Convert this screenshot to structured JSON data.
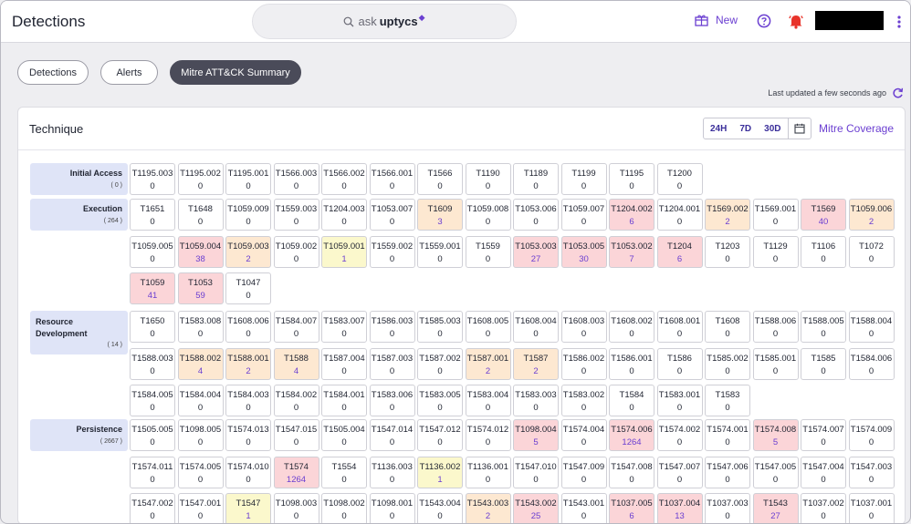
{
  "header": {
    "title": "Detections",
    "search_prefix": "ask",
    "search_brand": "uptycs",
    "new_label": "New"
  },
  "tabs": [
    {
      "label": "Detections",
      "active": false
    },
    {
      "label": "Alerts",
      "active": false
    },
    {
      "label": "Mitre ATT&CK Summary",
      "active": true
    }
  ],
  "last_updated": "Last updated a few seconds ago",
  "panel": {
    "title": "Technique",
    "ranges": [
      "24H",
      "7D",
      "30D"
    ],
    "coverage_label": "Mitre Coverage"
  },
  "tactics": [
    {
      "name": "Initial Access",
      "count": "( 0 )",
      "rows": [
        [
          [
            "T1195.003",
            "0"
          ],
          [
            "T1195.002",
            "0"
          ],
          [
            "T1195.001",
            "0"
          ],
          [
            "T1566.003",
            "0"
          ],
          [
            "T1566.002",
            "0"
          ],
          [
            "T1566.001",
            "0"
          ],
          [
            "T1566",
            "0"
          ],
          [
            "T1190",
            "0"
          ],
          [
            "T1189",
            "0"
          ],
          [
            "T1199",
            "0"
          ],
          [
            "T1195",
            "0"
          ],
          [
            "T1200",
            "0"
          ]
        ]
      ]
    },
    {
      "name": "Execution",
      "count": "( 264 )",
      "rows": [
        [
          [
            "T1651",
            "0"
          ],
          [
            "T1648",
            "0"
          ],
          [
            "T1059.009",
            "0"
          ],
          [
            "T1559.003",
            "0"
          ],
          [
            "T1204.003",
            "0"
          ],
          [
            "T1053.007",
            "0"
          ],
          [
            "T1609",
            "3"
          ],
          [
            "T1059.008",
            "0"
          ],
          [
            "T1053.006",
            "0"
          ],
          [
            "T1059.007",
            "0"
          ],
          [
            "T1204.002",
            "6"
          ],
          [
            "T1204.001",
            "0"
          ],
          [
            "T1569.002",
            "2"
          ],
          [
            "T1569.001",
            "0"
          ],
          [
            "T1569",
            "40"
          ],
          [
            "T1059.006",
            "2"
          ]
        ],
        [
          [
            "T1059.005",
            "0"
          ],
          [
            "T1059.004",
            "38"
          ],
          [
            "T1059.003",
            "2"
          ],
          [
            "T1059.002",
            "0"
          ],
          [
            "T1059.001",
            "1"
          ],
          [
            "T1559.002",
            "0"
          ],
          [
            "T1559.001",
            "0"
          ],
          [
            "T1559",
            "0"
          ],
          [
            "T1053.003",
            "27"
          ],
          [
            "T1053.005",
            "30"
          ],
          [
            "T1053.002",
            "7"
          ],
          [
            "T1204",
            "6"
          ],
          [
            "T1203",
            "0"
          ],
          [
            "T1129",
            "0"
          ],
          [
            "T1106",
            "0"
          ],
          [
            "T1072",
            "0"
          ]
        ],
        [
          [
            "T1059",
            "41"
          ],
          [
            "T1053",
            "59"
          ],
          [
            "T1047",
            "0"
          ]
        ]
      ]
    },
    {
      "name": "Resource Development",
      "count": "( 14 )",
      "rows": [
        [
          [
            "T1650",
            "0"
          ],
          [
            "T1583.008",
            "0"
          ],
          [
            "T1608.006",
            "0"
          ],
          [
            "T1584.007",
            "0"
          ],
          [
            "T1583.007",
            "0"
          ],
          [
            "T1586.003",
            "0"
          ],
          [
            "T1585.003",
            "0"
          ],
          [
            "T1608.005",
            "0"
          ],
          [
            "T1608.004",
            "0"
          ],
          [
            "T1608.003",
            "0"
          ],
          [
            "T1608.002",
            "0"
          ],
          [
            "T1608.001",
            "0"
          ],
          [
            "T1608",
            "0"
          ],
          [
            "T1588.006",
            "0"
          ],
          [
            "T1588.005",
            "0"
          ],
          [
            "T1588.004",
            "0"
          ]
        ],
        [
          [
            "T1588.003",
            "0"
          ],
          [
            "T1588.002",
            "4"
          ],
          [
            "T1588.001",
            "2"
          ],
          [
            "T1588",
            "4"
          ],
          [
            "T1587.004",
            "0"
          ],
          [
            "T1587.003",
            "0"
          ],
          [
            "T1587.002",
            "0"
          ],
          [
            "T1587.001",
            "2"
          ],
          [
            "T1587",
            "2"
          ],
          [
            "T1586.002",
            "0"
          ],
          [
            "T1586.001",
            "0"
          ],
          [
            "T1586",
            "0"
          ],
          [
            "T1585.002",
            "0"
          ],
          [
            "T1585.001",
            "0"
          ],
          [
            "T1585",
            "0"
          ],
          [
            "T1584.006",
            "0"
          ]
        ],
        [
          [
            "T1584.005",
            "0"
          ],
          [
            "T1584.004",
            "0"
          ],
          [
            "T1584.003",
            "0"
          ],
          [
            "T1584.002",
            "0"
          ],
          [
            "T1584.001",
            "0"
          ],
          [
            "T1583.006",
            "0"
          ],
          [
            "T1583.005",
            "0"
          ],
          [
            "T1583.004",
            "0"
          ],
          [
            "T1583.003",
            "0"
          ],
          [
            "T1583.002",
            "0"
          ],
          [
            "T1584",
            "0"
          ],
          [
            "T1583.001",
            "0"
          ],
          [
            "T1583",
            "0"
          ]
        ]
      ]
    },
    {
      "name": "Persistence",
      "count": "( 2667 )",
      "rows": [
        [
          [
            "T1505.005",
            "0"
          ],
          [
            "T1098.005",
            "0"
          ],
          [
            "T1574.013",
            "0"
          ],
          [
            "T1547.015",
            "0"
          ],
          [
            "T1505.004",
            "0"
          ],
          [
            "T1547.014",
            "0"
          ],
          [
            "T1547.012",
            "0"
          ],
          [
            "T1574.012",
            "0"
          ],
          [
            "T1098.004",
            "5"
          ],
          [
            "T1574.004",
            "0"
          ],
          [
            "T1574.006",
            "1264"
          ],
          [
            "T1574.002",
            "0"
          ],
          [
            "T1574.001",
            "0"
          ],
          [
            "T1574.008",
            "5"
          ],
          [
            "T1574.007",
            "0"
          ],
          [
            "T1574.009",
            "0"
          ]
        ],
        [
          [
            "T1574.011",
            "0"
          ],
          [
            "T1574.005",
            "0"
          ],
          [
            "T1574.010",
            "0"
          ],
          [
            "T1574",
            "1264"
          ],
          [
            "T1554",
            "0"
          ],
          [
            "T1136.003",
            "0"
          ],
          [
            "T1136.002",
            "1"
          ],
          [
            "T1136.001",
            "0"
          ],
          [
            "T1547.010",
            "0"
          ],
          [
            "T1547.009",
            "0"
          ],
          [
            "T1547.008",
            "0"
          ],
          [
            "T1547.007",
            "0"
          ],
          [
            "T1547.006",
            "0"
          ],
          [
            "T1547.005",
            "0"
          ],
          [
            "T1547.004",
            "0"
          ],
          [
            "T1547.003",
            "0"
          ]
        ],
        [
          [
            "T1547.002",
            "0"
          ],
          [
            "T1547.001",
            "0"
          ],
          [
            "T1547",
            "1"
          ],
          [
            "T1098.003",
            "0"
          ],
          [
            "T1098.002",
            "0"
          ],
          [
            "T1098.001",
            "0"
          ],
          [
            "T1543.004",
            "0"
          ],
          [
            "T1543.003",
            "2"
          ],
          [
            "T1543.002",
            "25"
          ],
          [
            "T1543.001",
            "0"
          ],
          [
            "T1037.005",
            "6"
          ],
          [
            "T1037.004",
            "13"
          ],
          [
            "T1037.003",
            "0"
          ],
          [
            "T1543",
            "27"
          ],
          [
            "T1037.002",
            "0"
          ],
          [
            "T1037.001",
            "0"
          ]
        ]
      ]
    }
  ],
  "cell_highlights": {
    "T1609": "orange",
    "T1204.002": "red",
    "T1569.002": "orange",
    "T1569": "red",
    "T1059.006": "orange",
    "T1059.004": "red",
    "T1059.003": "orange",
    "T1059.001": "yellow",
    "T1053.003": "red",
    "T1053.005": "red",
    "T1053.002": "red",
    "T1204": "red",
    "T1059": "red",
    "T1053": "red",
    "T1588.002": "orange",
    "T1588.001": "orange",
    "T1588": "orange",
    "T1587.001": "orange",
    "T1587": "orange",
    "T1098.004": "red",
    "T1574.006": "red",
    "T1574.008": "red",
    "T1574": "red",
    "T1136.002": "yellow",
    "T1547": "yellow",
    "T1543.003": "orange",
    "T1543.002": "red",
    "T1037.005": "red",
    "T1037.004": "red",
    "T1543": "red"
  },
  "icons": {
    "search": "search-icon",
    "new": "gift-icon",
    "help": "help-circle-icon",
    "bell": "bell-icon",
    "more": "more-vertical-icon",
    "refresh": "refresh-icon",
    "calendar": "calendar-icon"
  },
  "colors": {
    "accent": "#6b3fd1",
    "bell": "#e8332a",
    "active_tab": "#4a4b59",
    "tactic_bg": "#dfe4f7",
    "cell_orange": "#fde8d1",
    "cell_red": "#fbd5d8",
    "cell_yellow": "#fbf8cc"
  }
}
